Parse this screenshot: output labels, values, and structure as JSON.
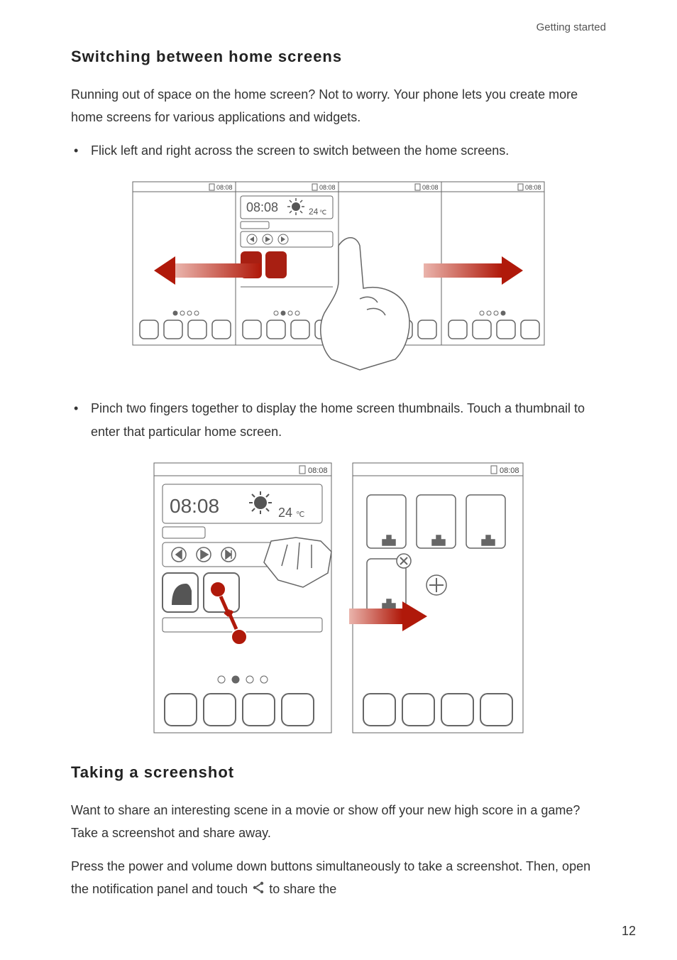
{
  "header": {
    "section": "Getting started"
  },
  "section1": {
    "title": "Switching between home screens",
    "intro": "Running out of space on the home screen? Not to worry. Your phone lets you create more home screens for various applications and widgets.",
    "bullet1": "Flick left and right across the screen to switch between the home screens.",
    "bullet2": "Pinch two fingers together to display the home screen thumbnails. Touch a thumbnail to enter that particular home screen."
  },
  "section2": {
    "title": "Taking a screenshot",
    "para1": "Want to share an interesting scene in a movie or show off your new high score in a game? Take a screenshot and share away.",
    "para2a": "Press the power and volume down buttons simultaneously to take a screenshot. Then, open the notification panel and touch ",
    "para2b": " to share the"
  },
  "figures": {
    "status_time": "08:08",
    "clock_time": "08:08",
    "temperature": "24",
    "temp_unit": "℃"
  },
  "page_number": "12"
}
